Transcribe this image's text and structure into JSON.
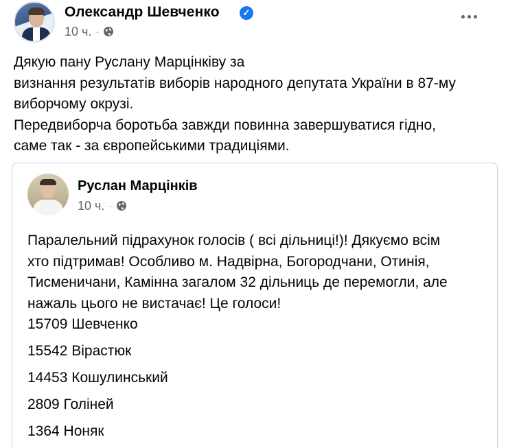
{
  "post": {
    "author": "Олександр Шевченко",
    "verified_icon": "verified-badge-icon",
    "time": "10 ч.",
    "separator": "·",
    "audience_icon": "globe-icon",
    "more_icon": "more-options-icon",
    "text_lines": [
      "Дякую пану Руслану Марцінківу за",
      "визнання результатів виборів народного депутата України в 87-му",
      "виборчому окрузі.",
      "Передвиборча боротьба завжди повинна завершуватися гідно,",
      "саме так - за європейськими традиціями."
    ]
  },
  "shared": {
    "author": "Руслан Марцінків",
    "time": "10 ч.",
    "separator": "·",
    "text_lines": [
      "Паралельний підрахунок голосів ( всі дільниці!)! Дякуємо всім",
      "хто підтримав! Особливо м. Надвірна, Богородчани, Отинія,",
      "Тисменичани, Камінна загалом 32 дільниць де перемогли, але",
      "нажаль цього не вистачає! Це голоси!"
    ],
    "results": [
      "15709 Шевченко",
      "15542 Вірастюк",
      "14453 Кошулинський",
      "2809 Голіней",
      "1364 Ноняк"
    ]
  },
  "colors": {
    "text": "#050505",
    "secondary": "#65676b",
    "verified": "#1877f2",
    "border": "#c9ccd1"
  }
}
